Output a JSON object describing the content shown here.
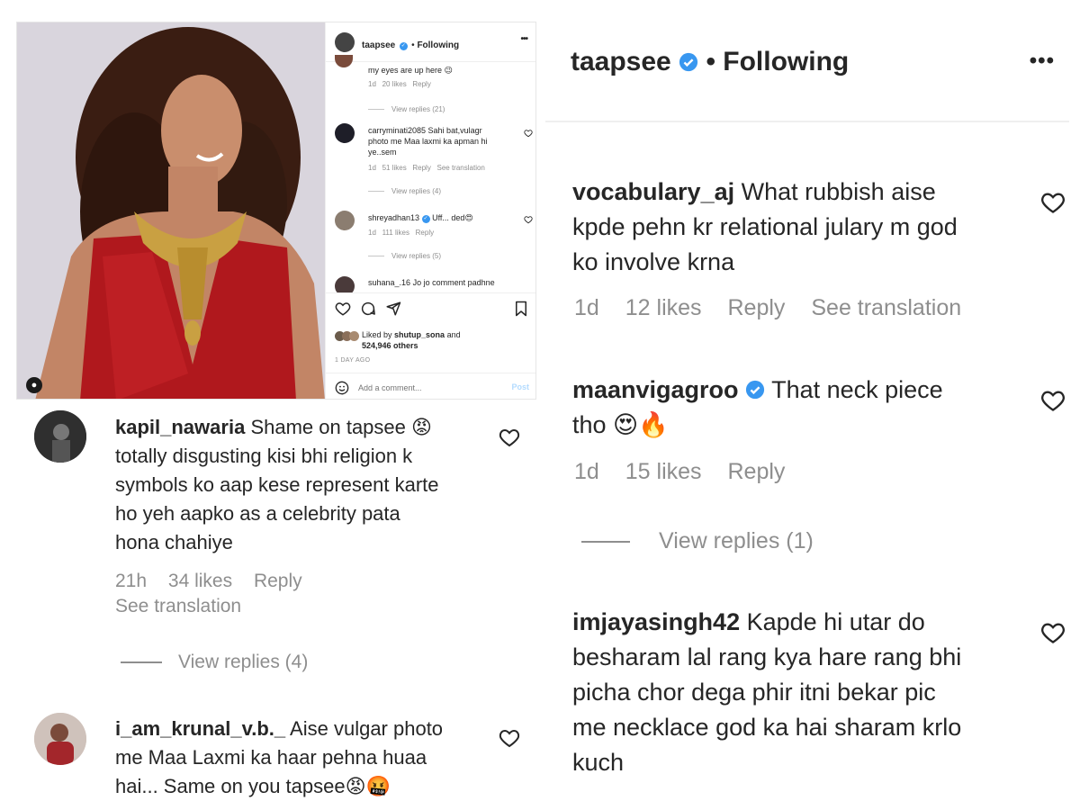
{
  "post": {
    "username": "taapsee",
    "follow_status": "Following",
    "more_label": "•••",
    "comments": [
      {
        "username": "",
        "text": "my eyes are up here 😉",
        "time": "1d",
        "likes": "20 likes",
        "reply": "Reply",
        "view_replies": "View replies (21)"
      },
      {
        "username": "carryminati2085",
        "text": "Sahi bat,vulagr photo me Maa laxmi ka apman hi ye..sem",
        "time": "1d",
        "likes": "51 likes",
        "reply": "Reply",
        "translation": "See translation",
        "view_replies": "View replies (4)"
      },
      {
        "username": "shreyadhan13",
        "text": "Uff... ded😍",
        "time": "1d",
        "likes": "111 likes",
        "reply": "Reply",
        "view_replies": "View replies (5)"
      },
      {
        "username": "suhana_.16",
        "text": "Jo jo comment padhne"
      }
    ],
    "liked_by_prefix": "Liked by",
    "liked_by_user": "shutup_sona",
    "liked_by_suffix": "and",
    "liked_by_others": "524,946 others",
    "timestamp": "1 DAY AGO",
    "comment_placeholder": "Add a comment...",
    "post_button": "Post"
  },
  "left_comments": [
    {
      "username": "kapil_nawaria",
      "lines": [
        "Shame on tapsee 😡",
        "totally disgusting kisi bhi religion k",
        "symbols ko aap kese represent karte",
        "ho yeh aapko as a celebrity pata",
        "hona chahiye"
      ],
      "time": "21h",
      "likes": "34 likes",
      "reply": "Reply",
      "translation": "See translation",
      "view_replies": "View replies (4)"
    },
    {
      "username": "i_am_krunal_v.b._",
      "lines": [
        "Aise vulgar photo",
        "me Maa Laxmi ka haar pehna huaa",
        "hai... Same on you tapsee😡🤬"
      ]
    }
  ],
  "right_panel": {
    "username": "taapsee",
    "follow_status": "Following",
    "more_label": "•••",
    "comments": [
      {
        "username": "vocabulary_aj",
        "lines": [
          "What rubbish aise",
          "kpde pehn kr relational julary m god",
          "ko involve krna"
        ],
        "time": "1d",
        "likes": "12 likes",
        "reply": "Reply",
        "translation": "See translation"
      },
      {
        "username": "maanvigagroo",
        "lines": [
          "That neck piece",
          "tho 😍🔥"
        ],
        "time": "1d",
        "likes": "15 likes",
        "reply": "Reply",
        "view_replies": "View replies (1)"
      },
      {
        "username": "imjayasingh42",
        "lines": [
          "Kapde hi utar do",
          "besharam lal rang kya hare rang bhi",
          "picha chor dega phir itni bekar pic",
          "me necklace god ka hai sharam krlo",
          "kuch"
        ]
      }
    ]
  },
  "colors": {
    "verified": "#3897f0",
    "meta": "#8e8e8e",
    "text": "#262626",
    "post_link": "#b3dbff"
  },
  "icons": [
    "heart-icon",
    "comment-icon",
    "share-icon",
    "bookmark-icon",
    "emoji-icon",
    "verified-icon",
    "more-icon",
    "person-tag-icon"
  ]
}
